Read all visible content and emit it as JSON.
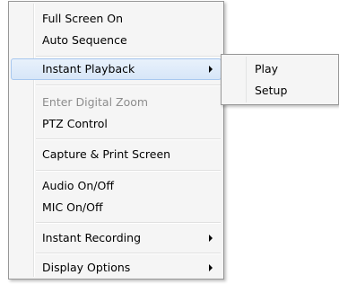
{
  "context_menu": {
    "items": [
      {
        "label": "Full Screen On"
      },
      {
        "label": "Auto Sequence"
      },
      {
        "label": "Instant Playback"
      },
      {
        "label": "Enter Digital Zoom"
      },
      {
        "label": "PTZ Control"
      },
      {
        "label": "Capture & Print Screen"
      },
      {
        "label": "Audio On/Off"
      },
      {
        "label": "MIC On/Off"
      },
      {
        "label": "Instant Recording"
      },
      {
        "label": "Display Options"
      }
    ]
  },
  "submenu": {
    "items": [
      {
        "label": "Play"
      },
      {
        "label": "Setup"
      }
    ]
  },
  "colors": {
    "menu_background": "#f5f5f5",
    "highlight_background": "#dce9f9",
    "highlight_border": "#a8c8ef",
    "disabled_text": "#8d8d8d"
  }
}
